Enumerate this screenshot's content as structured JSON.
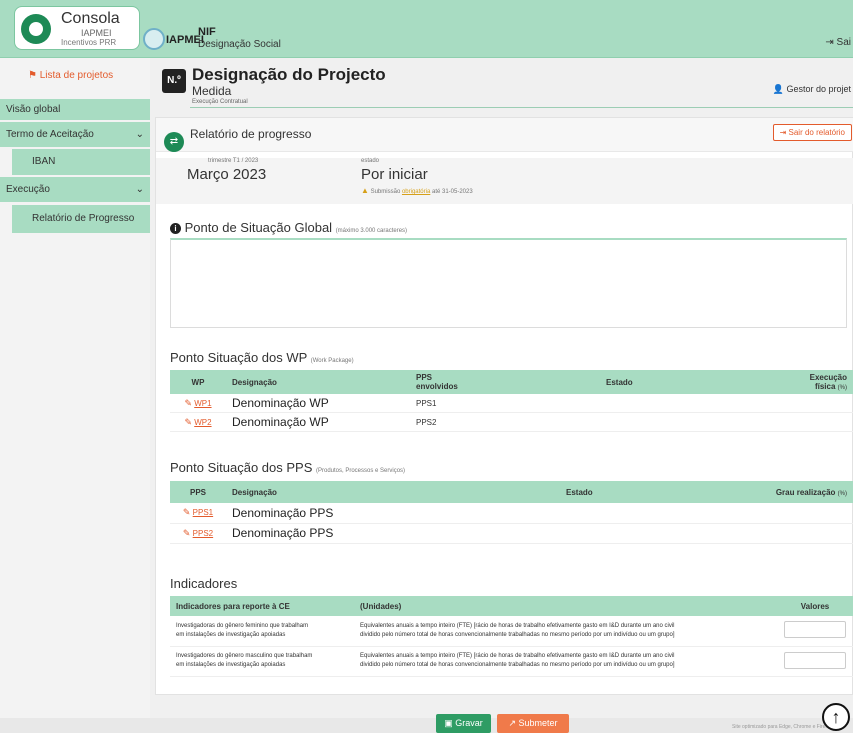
{
  "topbar": {
    "brand_title": "Consola",
    "brand_sub1": "IAPMEI",
    "brand_sub2": "Incentivos PRR",
    "agency": "IAPMEI",
    "nif": "NIF",
    "designacao_social": "Designação Social",
    "logout": "Sai"
  },
  "sidebar": {
    "projects_link": "Lista de projetos",
    "items": [
      {
        "label": "Visão global"
      },
      {
        "label": "Termo de Aceitação"
      },
      {
        "label": "IBAN"
      },
      {
        "label": "Execução"
      },
      {
        "label": "Relatório de Progresso"
      }
    ]
  },
  "project": {
    "badge": "N.º",
    "title": "Designação do Projecto",
    "medida": "Medida",
    "exec": "Execução Contratual",
    "gestor": "Gestor do projet"
  },
  "report": {
    "title": "Relatório de progresso",
    "exit": "Sair do relatório",
    "period_label": "trimestre T1 / 2023",
    "period_value": "Março 2023",
    "state_label": "estado",
    "state_value": "Por iniciar",
    "submission_prefix": "Submissão",
    "submission_link": "obrigatória",
    "submission_suffix": "até 31-05-2023"
  },
  "global_status": {
    "title": "Ponto de Situação Global",
    "hint": "(máximo 3.000 caracteres)"
  },
  "wp": {
    "title": "Ponto Situação dos WP",
    "hint": "(Work Package)",
    "headers": {
      "wp": "WP",
      "designacao": "Designação",
      "pps_line1": "PPS",
      "pps_line2": "envolvidos",
      "estado": "Estado",
      "exec_line1": "Execução",
      "exec_line2": "física",
      "exec_unit": "(%)"
    },
    "rows": [
      {
        "code": "WP1",
        "name": "Denominação WP",
        "pps": "PPS1"
      },
      {
        "code": "WP2",
        "name": "Denominação WP",
        "pps": "PPS2"
      }
    ]
  },
  "pps": {
    "title": "Ponto Situação dos PPS",
    "hint": "(Produtos, Processos e Serviços)",
    "headers": {
      "pps": "PPS",
      "designacao": "Designação",
      "estado": "Estado",
      "grau": "Grau realização",
      "grau_unit": "(%)"
    },
    "rows": [
      {
        "code": "PPS1",
        "name": "Denominação  PPS"
      },
      {
        "code": "PPS2",
        "name": "Denominação PPS"
      }
    ]
  },
  "indicators": {
    "title": "Indicadores",
    "headers": {
      "indicador": "Indicadores para reporte à CE",
      "unidades": "(Unidades)",
      "valores": "Valores"
    },
    "rows": [
      {
        "ind_line1": "Investigadoras do gênero feminino que trabalham",
        "ind_line2": "em instalações de investigação apoiadas",
        "unit_line1": "Equivalentes anuais a tempo inteiro (FTE) [rácio de horas de trabalho efetivamente gasto em I&D durante um ano civil",
        "unit_line2": "dividido pelo número total de horas convencionalmente trabalhadas no mesmo período por um indivíduo ou um grupo]"
      },
      {
        "ind_line1": "Investigadores do gênero masculino que trabalham",
        "ind_line2": "em instalações de investigação apoiadas",
        "unit_line1": "Equivalentes anuais a tempo inteiro (FTE) [rácio de horas de trabalho efetivamente gasto em I&D durante um ano civil",
        "unit_line2": "dividido pelo número total de horas convencionalmente trabalhadas no mesmo período por um indivíduo ou um grupo]"
      }
    ]
  },
  "footer": {
    "gravar": "Gravar",
    "submeter": "Submeter",
    "browser_note": "Site optimizado para Edge, Chrome e Firefox"
  },
  "colors": {
    "brand_green": "#a8dcc2",
    "dark_green": "#1d8a56",
    "accent_orange": "#e35b2c"
  },
  "icons": {
    "brand": "consola-logo-icon",
    "agency": "iapmei-logo-icon",
    "logout": "logout-icon",
    "projects": "projects-list-icon",
    "user": "user-icon",
    "exit": "exit-icon",
    "report": "report-icon",
    "warning": "warning-icon",
    "info": "info-icon",
    "edit": "edit-icon",
    "save": "save-icon",
    "submit": "submit-icon",
    "scroll_top": "arrow-up-icon"
  }
}
